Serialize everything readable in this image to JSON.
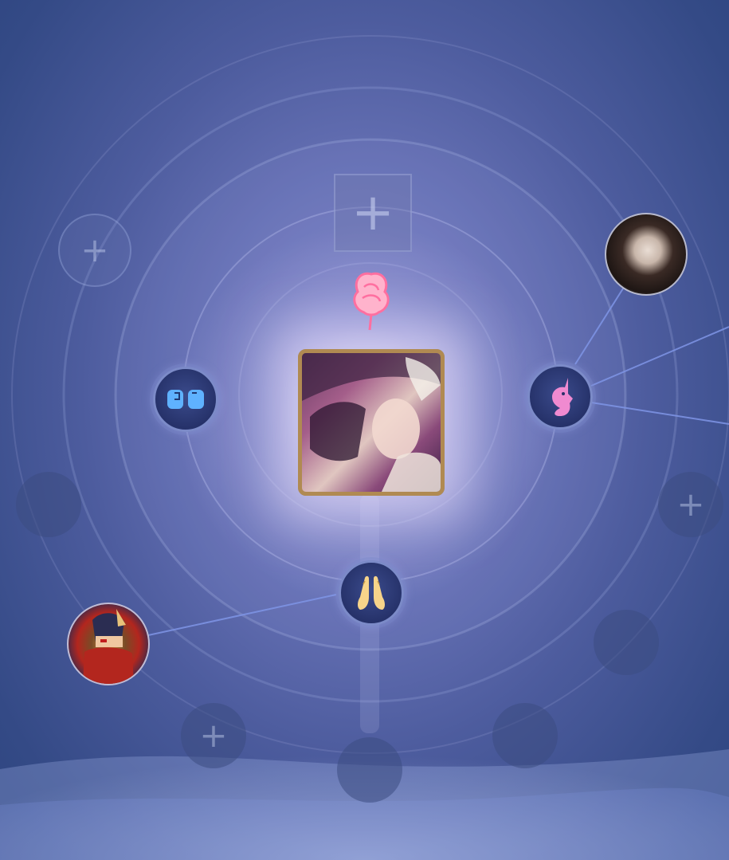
{
  "colors": {
    "background_dark": "#2d4580",
    "background_light": "#8e8fd0",
    "frame_gold": "#b08a52",
    "link_line": "#7f95e6",
    "rose_pink": "#ff8fb3",
    "unicorn_pink": "#f08ad0",
    "fist_blue": "#5fb2ff",
    "hands_gold": "#f7d48a"
  },
  "icons": {
    "top": "plus-icon",
    "rose": "rose-icon",
    "left_node": "fist-bump-icon",
    "right_node": "unicorn-icon",
    "bottom_node": "clapping-hands-icon",
    "empty_slot": "plus-icon"
  },
  "slots": {
    "plus_symbol": "+"
  }
}
